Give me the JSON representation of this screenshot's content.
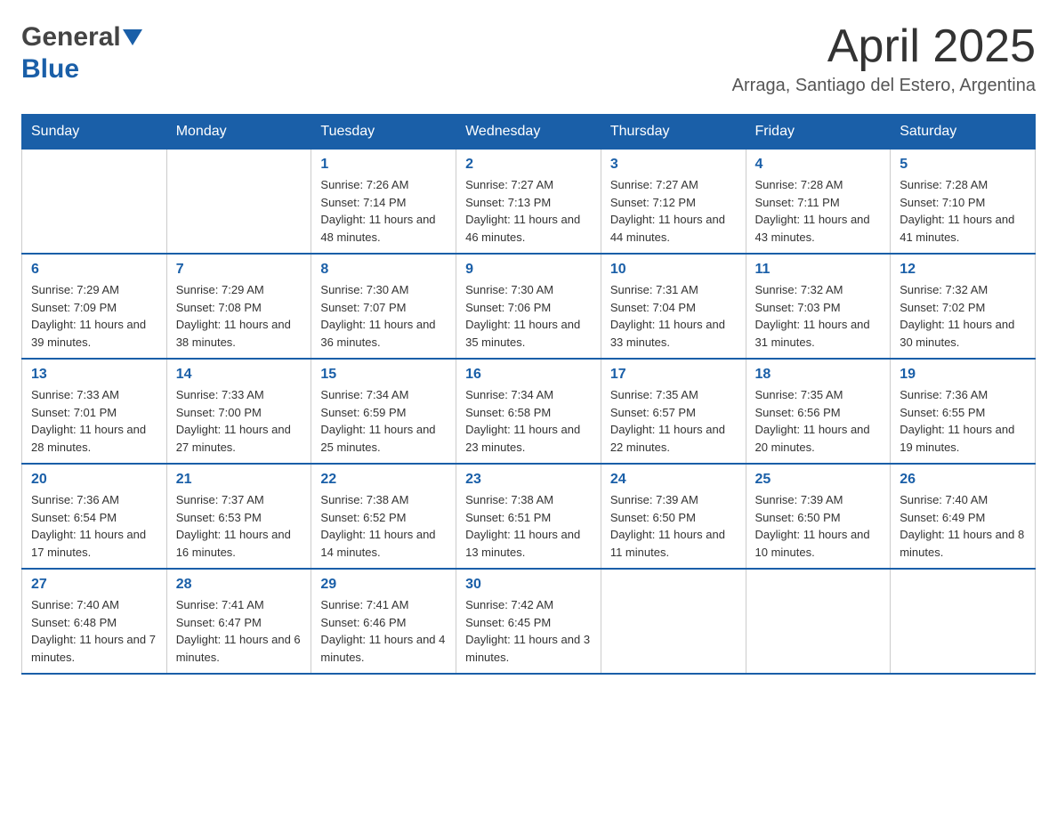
{
  "header": {
    "logo_general": "General",
    "logo_blue": "Blue",
    "month_year": "April 2025",
    "location": "Arraga, Santiago del Estero, Argentina"
  },
  "weekdays": [
    "Sunday",
    "Monday",
    "Tuesday",
    "Wednesday",
    "Thursday",
    "Friday",
    "Saturday"
  ],
  "weeks": [
    [
      {
        "day": "",
        "sunrise": "",
        "sunset": "",
        "daylight": ""
      },
      {
        "day": "",
        "sunrise": "",
        "sunset": "",
        "daylight": ""
      },
      {
        "day": "1",
        "sunrise": "Sunrise: 7:26 AM",
        "sunset": "Sunset: 7:14 PM",
        "daylight": "Daylight: 11 hours and 48 minutes."
      },
      {
        "day": "2",
        "sunrise": "Sunrise: 7:27 AM",
        "sunset": "Sunset: 7:13 PM",
        "daylight": "Daylight: 11 hours and 46 minutes."
      },
      {
        "day": "3",
        "sunrise": "Sunrise: 7:27 AM",
        "sunset": "Sunset: 7:12 PM",
        "daylight": "Daylight: 11 hours and 44 minutes."
      },
      {
        "day": "4",
        "sunrise": "Sunrise: 7:28 AM",
        "sunset": "Sunset: 7:11 PM",
        "daylight": "Daylight: 11 hours and 43 minutes."
      },
      {
        "day": "5",
        "sunrise": "Sunrise: 7:28 AM",
        "sunset": "Sunset: 7:10 PM",
        "daylight": "Daylight: 11 hours and 41 minutes."
      }
    ],
    [
      {
        "day": "6",
        "sunrise": "Sunrise: 7:29 AM",
        "sunset": "Sunset: 7:09 PM",
        "daylight": "Daylight: 11 hours and 39 minutes."
      },
      {
        "day": "7",
        "sunrise": "Sunrise: 7:29 AM",
        "sunset": "Sunset: 7:08 PM",
        "daylight": "Daylight: 11 hours and 38 minutes."
      },
      {
        "day": "8",
        "sunrise": "Sunrise: 7:30 AM",
        "sunset": "Sunset: 7:07 PM",
        "daylight": "Daylight: 11 hours and 36 minutes."
      },
      {
        "day": "9",
        "sunrise": "Sunrise: 7:30 AM",
        "sunset": "Sunset: 7:06 PM",
        "daylight": "Daylight: 11 hours and 35 minutes."
      },
      {
        "day": "10",
        "sunrise": "Sunrise: 7:31 AM",
        "sunset": "Sunset: 7:04 PM",
        "daylight": "Daylight: 11 hours and 33 minutes."
      },
      {
        "day": "11",
        "sunrise": "Sunrise: 7:32 AM",
        "sunset": "Sunset: 7:03 PM",
        "daylight": "Daylight: 11 hours and 31 minutes."
      },
      {
        "day": "12",
        "sunrise": "Sunrise: 7:32 AM",
        "sunset": "Sunset: 7:02 PM",
        "daylight": "Daylight: 11 hours and 30 minutes."
      }
    ],
    [
      {
        "day": "13",
        "sunrise": "Sunrise: 7:33 AM",
        "sunset": "Sunset: 7:01 PM",
        "daylight": "Daylight: 11 hours and 28 minutes."
      },
      {
        "day": "14",
        "sunrise": "Sunrise: 7:33 AM",
        "sunset": "Sunset: 7:00 PM",
        "daylight": "Daylight: 11 hours and 27 minutes."
      },
      {
        "day": "15",
        "sunrise": "Sunrise: 7:34 AM",
        "sunset": "Sunset: 6:59 PM",
        "daylight": "Daylight: 11 hours and 25 minutes."
      },
      {
        "day": "16",
        "sunrise": "Sunrise: 7:34 AM",
        "sunset": "Sunset: 6:58 PM",
        "daylight": "Daylight: 11 hours and 23 minutes."
      },
      {
        "day": "17",
        "sunrise": "Sunrise: 7:35 AM",
        "sunset": "Sunset: 6:57 PM",
        "daylight": "Daylight: 11 hours and 22 minutes."
      },
      {
        "day": "18",
        "sunrise": "Sunrise: 7:35 AM",
        "sunset": "Sunset: 6:56 PM",
        "daylight": "Daylight: 11 hours and 20 minutes."
      },
      {
        "day": "19",
        "sunrise": "Sunrise: 7:36 AM",
        "sunset": "Sunset: 6:55 PM",
        "daylight": "Daylight: 11 hours and 19 minutes."
      }
    ],
    [
      {
        "day": "20",
        "sunrise": "Sunrise: 7:36 AM",
        "sunset": "Sunset: 6:54 PM",
        "daylight": "Daylight: 11 hours and 17 minutes."
      },
      {
        "day": "21",
        "sunrise": "Sunrise: 7:37 AM",
        "sunset": "Sunset: 6:53 PM",
        "daylight": "Daylight: 11 hours and 16 minutes."
      },
      {
        "day": "22",
        "sunrise": "Sunrise: 7:38 AM",
        "sunset": "Sunset: 6:52 PM",
        "daylight": "Daylight: 11 hours and 14 minutes."
      },
      {
        "day": "23",
        "sunrise": "Sunrise: 7:38 AM",
        "sunset": "Sunset: 6:51 PM",
        "daylight": "Daylight: 11 hours and 13 minutes."
      },
      {
        "day": "24",
        "sunrise": "Sunrise: 7:39 AM",
        "sunset": "Sunset: 6:50 PM",
        "daylight": "Daylight: 11 hours and 11 minutes."
      },
      {
        "day": "25",
        "sunrise": "Sunrise: 7:39 AM",
        "sunset": "Sunset: 6:50 PM",
        "daylight": "Daylight: 11 hours and 10 minutes."
      },
      {
        "day": "26",
        "sunrise": "Sunrise: 7:40 AM",
        "sunset": "Sunset: 6:49 PM",
        "daylight": "Daylight: 11 hours and 8 minutes."
      }
    ],
    [
      {
        "day": "27",
        "sunrise": "Sunrise: 7:40 AM",
        "sunset": "Sunset: 6:48 PM",
        "daylight": "Daylight: 11 hours and 7 minutes."
      },
      {
        "day": "28",
        "sunrise": "Sunrise: 7:41 AM",
        "sunset": "Sunset: 6:47 PM",
        "daylight": "Daylight: 11 hours and 6 minutes."
      },
      {
        "day": "29",
        "sunrise": "Sunrise: 7:41 AM",
        "sunset": "Sunset: 6:46 PM",
        "daylight": "Daylight: 11 hours and 4 minutes."
      },
      {
        "day": "30",
        "sunrise": "Sunrise: 7:42 AM",
        "sunset": "Sunset: 6:45 PM",
        "daylight": "Daylight: 11 hours and 3 minutes."
      },
      {
        "day": "",
        "sunrise": "",
        "sunset": "",
        "daylight": ""
      },
      {
        "day": "",
        "sunrise": "",
        "sunset": "",
        "daylight": ""
      },
      {
        "day": "",
        "sunrise": "",
        "sunset": "",
        "daylight": ""
      }
    ]
  ]
}
